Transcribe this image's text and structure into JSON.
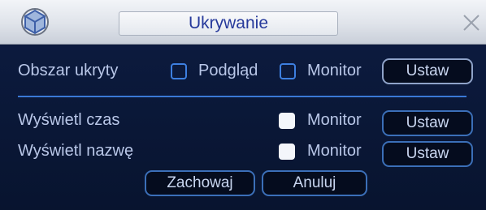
{
  "window": {
    "title": "Ukrywanie"
  },
  "mask_row": {
    "label": "Obszar ukryty",
    "preview_label": "Podgląd",
    "monitor_label": "Monitor",
    "set_label": "Ustaw"
  },
  "time_row": {
    "label": "Wyświetl czas",
    "monitor_label": "Monitor",
    "set_label": "Ustaw"
  },
  "name_row": {
    "label": "Wyświetl nazwę",
    "monitor_label": "Monitor",
    "set_label": "Ustaw"
  },
  "footer": {
    "save_label": "Zachowaj",
    "cancel_label": "Anuluj"
  }
}
